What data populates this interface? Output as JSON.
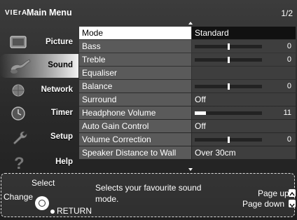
{
  "header": {
    "brand": "VIErA",
    "title": "Main Menu",
    "page": "1/2"
  },
  "sidebar": {
    "items": [
      {
        "label": "Picture",
        "icon": "picture-icon"
      },
      {
        "label": "Sound",
        "icon": "music-note-icon",
        "selected": true
      },
      {
        "label": "Network",
        "icon": "globe-icon"
      },
      {
        "label": "Timer",
        "icon": "clock-icon"
      },
      {
        "label": "Setup",
        "icon": "wrench-icon"
      },
      {
        "label": "Help",
        "icon": "question-mark-icon"
      }
    ]
  },
  "menu": {
    "rows": [
      {
        "label": "Mode",
        "value": "Standard",
        "selected": true
      },
      {
        "label": "Bass",
        "slider": 0.5,
        "number": "0"
      },
      {
        "label": "Treble",
        "slider": 0.5,
        "number": "0"
      },
      {
        "label": "Equaliser",
        "value": ""
      },
      {
        "label": "Balance",
        "slider": 0.5,
        "number": "0"
      },
      {
        "label": "Surround",
        "value": "Off"
      },
      {
        "label": "Headphone Volume",
        "fill": 0.17,
        "number": "11"
      },
      {
        "label": "Auto Gain Control",
        "value": "Off"
      },
      {
        "label": "Volume Correction",
        "slider": 0.5,
        "number": "0"
      },
      {
        "label": "Speaker Distance to Wall",
        "value": "Over 30cm"
      }
    ]
  },
  "help": {
    "select": "Select",
    "change": "Change",
    "return": "RETURN",
    "description_line1": "Selects your favourite sound",
    "description_line2": "mode.",
    "page_up": "Page up",
    "page_down": "Page down"
  }
}
